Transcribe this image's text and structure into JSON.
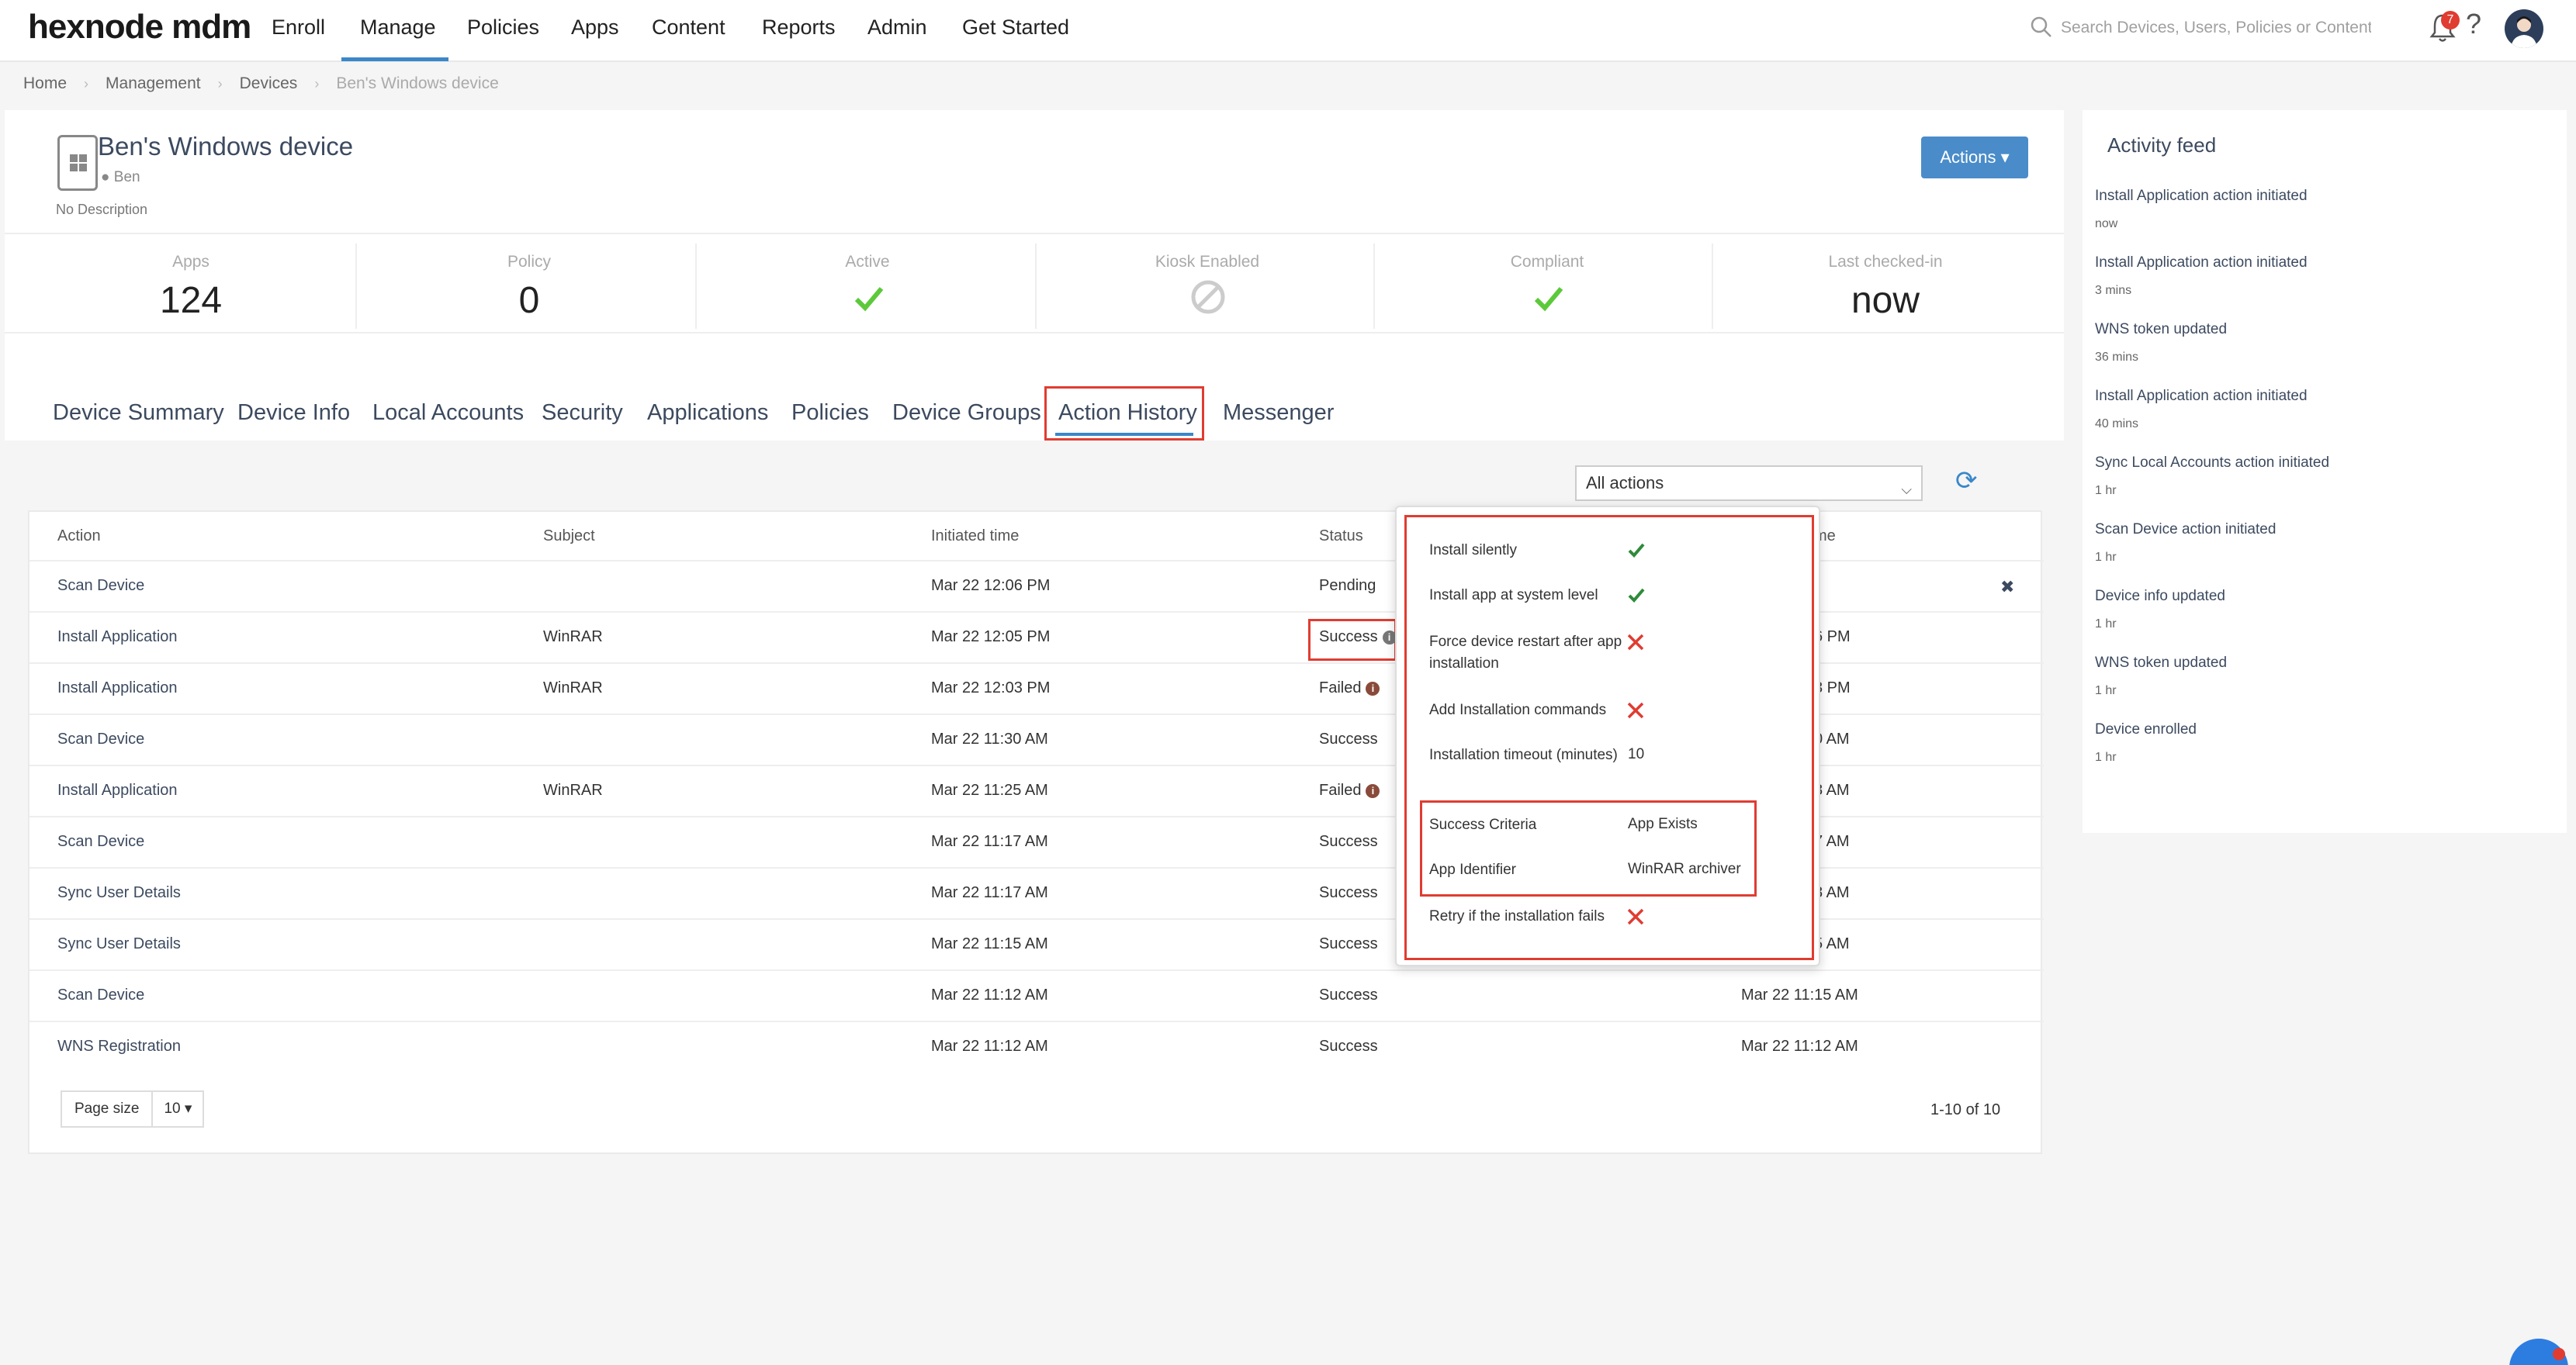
{
  "app": {
    "logo": "hexnode mdm"
  },
  "nav": {
    "items": [
      "Enroll",
      "Manage",
      "Policies",
      "Apps",
      "Content",
      "Reports",
      "Admin",
      "Get Started"
    ],
    "active": "Manage"
  },
  "search": {
    "placeholder": "Search Devices, Users, Policies or Content"
  },
  "notifications": {
    "count": "7"
  },
  "breadcrumb": [
    "Home",
    "Management",
    "Devices",
    "Ben's Windows device"
  ],
  "device": {
    "name": "Ben's Windows device",
    "user": "Ben",
    "description": "No Description"
  },
  "actions_button": "Actions",
  "stats": [
    {
      "label": "Apps",
      "value": "124"
    },
    {
      "label": "Policy",
      "value": "0"
    },
    {
      "label": "Active",
      "icon": "check-icon"
    },
    {
      "label": "Kiosk Enabled",
      "icon": "disabled-icon"
    },
    {
      "label": "Compliant",
      "icon": "check-icon"
    },
    {
      "label": "Last checked-in",
      "value": "now"
    }
  ],
  "tabs": [
    "Device Summary",
    "Device Info",
    "Local Accounts",
    "Security",
    "Applications",
    "Policies",
    "Device Groups",
    "Action History",
    "Messenger"
  ],
  "active_tab": "Action History",
  "filter": {
    "selected": "All actions"
  },
  "table": {
    "headers": [
      "Action",
      "Subject",
      "Initiated time",
      "Status",
      "me"
    ],
    "rows": [
      {
        "action": "Scan Device",
        "subject": "",
        "initiated": "Mar 22 12:06 PM",
        "status": "Pending",
        "completed": ""
      },
      {
        "action": "Install Application",
        "subject": "WinRAR",
        "initiated": "Mar 22 12:05 PM",
        "status": "Success",
        "completed": "6 PM"
      },
      {
        "action": "Install Application",
        "subject": "WinRAR",
        "initiated": "Mar 22 12:03 PM",
        "status": "Failed",
        "completed": "3 PM"
      },
      {
        "action": "Scan Device",
        "subject": "",
        "initiated": "Mar 22 11:30 AM",
        "status": "Success",
        "completed": "0 AM"
      },
      {
        "action": "Install Application",
        "subject": "WinRAR",
        "initiated": "Mar 22 11:25 AM",
        "status": "Failed",
        "completed": "8 AM"
      },
      {
        "action": "Scan Device",
        "subject": "",
        "initiated": "Mar 22 11:17 AM",
        "status": "Success",
        "completed": "7 AM"
      },
      {
        "action": "Sync User Details",
        "subject": "",
        "initiated": "Mar 22 11:17 AM",
        "status": "Success",
        "completed": "8 AM"
      },
      {
        "action": "Sync User Details",
        "subject": "",
        "initiated": "Mar 22 11:15 AM",
        "status": "Success",
        "completed": "5 AM"
      },
      {
        "action": "Scan Device",
        "subject": "",
        "initiated": "Mar 22 11:12 AM",
        "status": "Success",
        "completed": "Mar 22 11:15 AM"
      },
      {
        "action": "WNS Registration",
        "subject": "",
        "initiated": "Mar 22 11:12 AM",
        "status": "Success",
        "completed": "Mar 22 11:12 AM"
      }
    ]
  },
  "pagination": {
    "page_size_label": "Page size",
    "page_size": "10",
    "info": "1-10 of 10"
  },
  "popover": {
    "items": [
      {
        "label": "Install silently",
        "type": "check"
      },
      {
        "label": "Install app at system level",
        "type": "check"
      },
      {
        "label": "Force device restart after app installation",
        "type": "cross"
      },
      {
        "label": "Add Installation commands",
        "type": "cross"
      },
      {
        "label": "Installation timeout (minutes)",
        "value": "10"
      },
      {
        "label": "Success Criteria",
        "value": "App Exists"
      },
      {
        "label": "App Identifier",
        "value": "WinRAR archiver"
      },
      {
        "label": "Retry if the installation fails",
        "type": "cross"
      }
    ]
  },
  "feed": {
    "title": "Activity feed",
    "items": [
      {
        "text": "Install Application action initiated",
        "time": "now"
      },
      {
        "text": "Install Application action initiated",
        "time": "3 mins"
      },
      {
        "text": "WNS token updated",
        "time": "36 mins"
      },
      {
        "text": "Install Application action initiated",
        "time": "40 mins"
      },
      {
        "text": "Sync Local Accounts action initiated",
        "time": "1 hr"
      },
      {
        "text": "Scan Device action initiated",
        "time": "1 hr"
      },
      {
        "text": "Device info updated",
        "time": "1 hr"
      },
      {
        "text": "WNS token updated",
        "time": "1 hr"
      },
      {
        "text": "Device enrolled",
        "time": "1 hr"
      }
    ]
  },
  "colors": {
    "accent": "#3a87c9",
    "highlight": "#e03c31",
    "success": "#5cb85c",
    "failed": "#8a4a3a"
  }
}
